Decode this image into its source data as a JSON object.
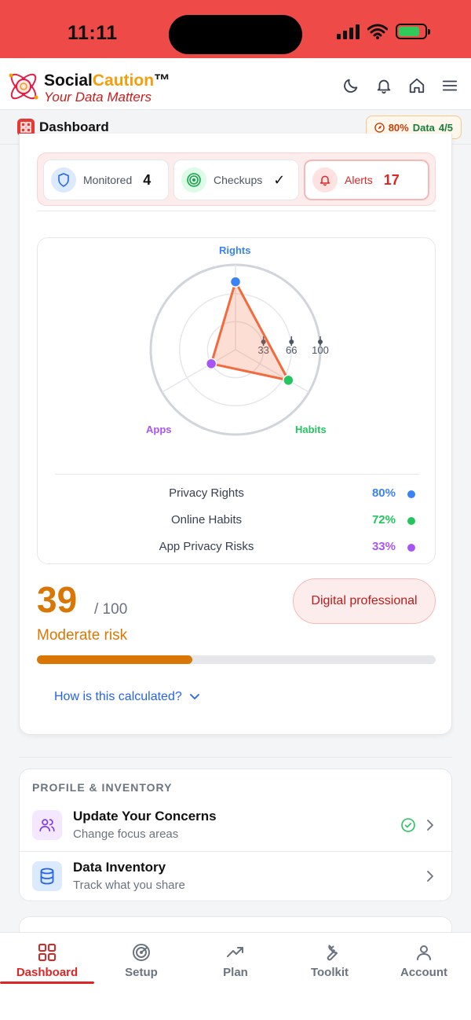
{
  "status_bar": {
    "time": "11:11",
    "battery_level": 0.8,
    "background": "#ee4b48"
  },
  "header": {
    "brand_part1": "Social",
    "brand_part2": "Caution",
    "brand_tm": "™",
    "tagline": "Your Data Matters",
    "actions": [
      "moon-icon",
      "bell-icon",
      "home-icon",
      "menu-icon"
    ]
  },
  "dashbar": {
    "title": "Dashboard",
    "data_chip": {
      "percent": "80%",
      "label": "Data",
      "fraction": "4/5"
    }
  },
  "stats": [
    {
      "label": "Monitored",
      "value": "4",
      "icon": "shield-icon"
    },
    {
      "label": "Checkups",
      "value": "✓",
      "icon": "target-icon"
    },
    {
      "label": "Alerts",
      "value": "17",
      "icon": "bell-icon"
    }
  ],
  "chart_data": {
    "type": "radar",
    "axes": [
      "Rights",
      "Habits",
      "Apps"
    ],
    "ticks": [
      "33",
      "66",
      "100"
    ],
    "range": [
      0,
      100
    ],
    "values": [
      80,
      72,
      33
    ],
    "colors": {
      "line": "#f26a3d",
      "fill": "#f26a3d",
      "rights": "#3b82f6",
      "habits": "#22c55e",
      "apps": "#a855f7"
    },
    "legend": [
      {
        "name": "Privacy Rights",
        "value": "80%",
        "color": "#3b82f6"
      },
      {
        "name": "Online Habits",
        "value": "72%",
        "color": "#22c55e"
      },
      {
        "name": "App Privacy Risks",
        "value": "33%",
        "color": "#a855f7"
      }
    ]
  },
  "score": {
    "value": "39",
    "max": "/ 100",
    "risk_label": "Moderate risk",
    "progress": 0.39,
    "persona": "Digital professional",
    "calc_link": "How is this calculated?",
    "accent": "#d97706"
  },
  "profile": {
    "section_title": "PROFILE & INVENTORY",
    "rows": [
      {
        "title": "Update Your Concerns",
        "subtitle": "Change focus areas",
        "icon": "users-icon",
        "completed": true
      },
      {
        "title": "Data Inventory",
        "subtitle": "Track what you share",
        "icon": "database-icon",
        "completed": false
      }
    ]
  },
  "bottom_nav": [
    {
      "label": "Dashboard",
      "icon": "dashboard-icon",
      "active": true
    },
    {
      "label": "Setup",
      "icon": "radar-icon",
      "active": false
    },
    {
      "label": "Plan",
      "icon": "trend-icon",
      "active": false
    },
    {
      "label": "Toolkit",
      "icon": "wrench-icon",
      "active": false
    },
    {
      "label": "Account",
      "icon": "user-icon",
      "active": false
    }
  ]
}
